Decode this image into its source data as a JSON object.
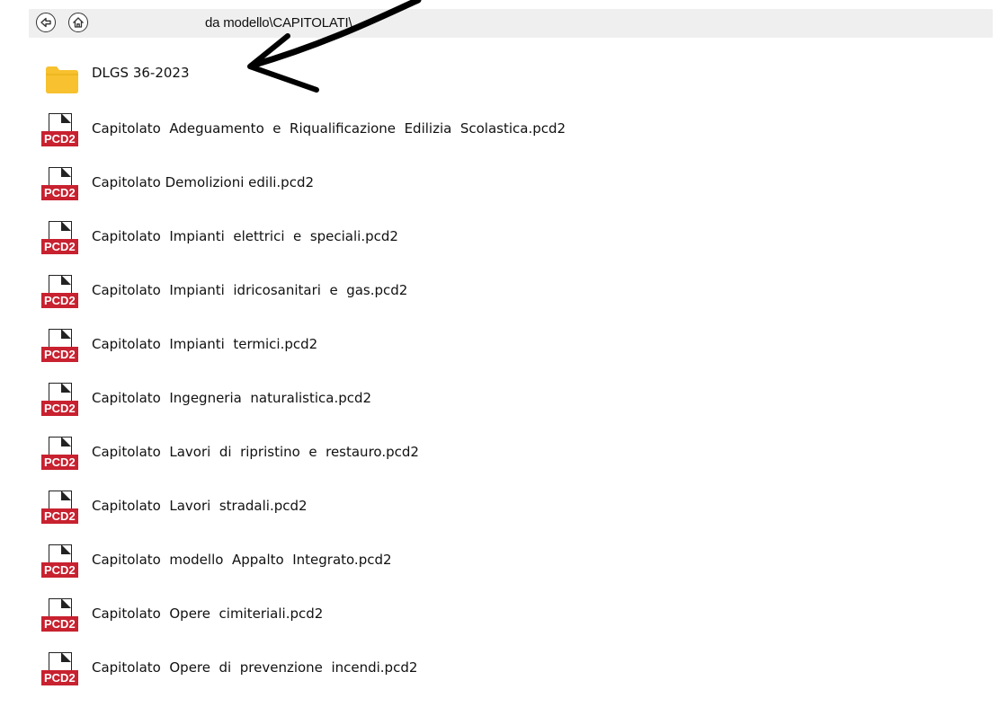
{
  "toolbar": {
    "back_icon": "arrow-left-circle-icon",
    "home_icon": "home-circle-icon",
    "path": "da modello\\CAPITOLATI\\"
  },
  "folder": {
    "icon": "folder-icon",
    "color": "#f7c12f",
    "label": "DLGS 36-2023"
  },
  "file_tag": "PCD2",
  "file_tag_color": "#c8212f",
  "files": [
    "Capitolato  Adeguamento  e  Riqualificazione  Edilizia  Scolastica.pcd2",
    "Capitolato Demolizioni edili.pcd2",
    "Capitolato  Impianti  elettrici  e  speciali.pcd2",
    "Capitolato  Impianti  idricosanitari  e  gas.pcd2",
    "Capitolato  Impianti  termici.pcd2",
    "Capitolato  Ingegneria  naturalistica.pcd2",
    "Capitolato  Lavori  di  ripristino  e  restauro.pcd2",
    "Capitolato  Lavori  stradali.pcd2",
    "Capitolato  modello  Appalto  Integrato.pcd2",
    "Capitolato  Opere  cimiteriali.pcd2",
    "Capitolato  Opere  di  prevenzione  incendi.pcd2"
  ]
}
